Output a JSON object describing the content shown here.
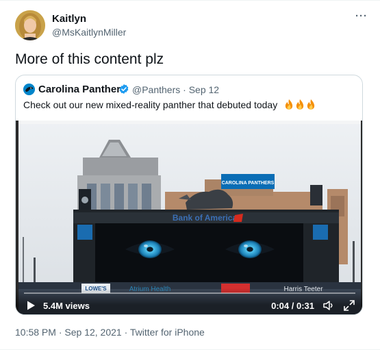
{
  "tweet": {
    "author_name": "Kaitlyn",
    "author_handle": "@MsKaitlynMiller",
    "more_icon": "more-horizontal-icon",
    "text": "More of this content plz",
    "timestamp": "10:58 PM",
    "date": "Sep 12, 2021",
    "separator": " · ",
    "source": "Twitter for iPhone"
  },
  "quoted": {
    "author_name": "Carolina Panthers",
    "verified": true,
    "author_handle": "@Panthers",
    "date_sep": " · ",
    "date": "Sep 12",
    "text": "Check out our new mixed-reality panther that debuted today",
    "emojis": [
      "fire",
      "fire",
      "fire"
    ],
    "video": {
      "views": "5.4M views",
      "time": "0:04 / 0:31",
      "scene_text": {
        "bank": "Bank of America",
        "sign_top": "CAROLINA PANTHERS",
        "lowes": "LOWE'S",
        "atrium": "Atrium Health",
        "harris": "Harris Teeter"
      }
    }
  },
  "colors": {
    "accent": "#1d9bf0",
    "secondary_text": "#536471",
    "border": "#cfd9de",
    "panther_blue": "#0085ca",
    "eye_blue": "#2fa6d6"
  }
}
